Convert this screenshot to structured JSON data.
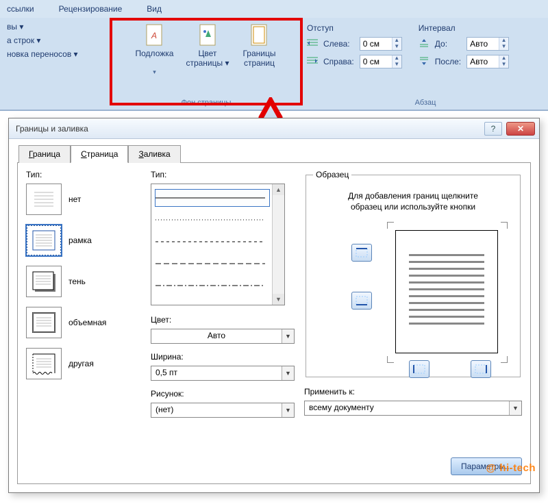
{
  "ribbon": {
    "tabs": [
      "ссылки",
      "Рецензирование",
      "Вид"
    ],
    "group_page_setup": {
      "items": [
        "вы ▾",
        "а строк ▾",
        "новка переносов ▾"
      ]
    },
    "group_page_bg": {
      "caption": "Фон страницы",
      "watermark": "Подложка",
      "page_color": "Цвет\nстраницы ▾",
      "page_borders": "Границы\nстраниц"
    },
    "group_indent": {
      "caption": "Отступ",
      "left_label": "Слева:",
      "right_label": "Справа:",
      "left_value": "0 см",
      "right_value": "0 см"
    },
    "group_spacing": {
      "caption": "Интервал",
      "before_label": "До:",
      "after_label": "После:",
      "before_value": "Авто",
      "after_value": "Авто"
    },
    "paragraph_caption": "Абзац"
  },
  "dialog": {
    "title": "Границы и заливка",
    "tabs": {
      "border": "Граница",
      "page": "Страница",
      "shading": "Заливка"
    },
    "type_label": "Тип:",
    "types": {
      "none": "нет",
      "box": "рамка",
      "shadow": "тень",
      "threeD": "объемная",
      "custom": "другая"
    },
    "style_label": "Тип:",
    "color_label": "Цвет:",
    "color_value": "Авто",
    "width_label": "Ширина:",
    "width_value": "0,5 пт",
    "art_label": "Рисунок:",
    "art_value": "(нет)",
    "preview_label": "Образец",
    "preview_hint": "Для добавления границ щелкните образец или используйте кнопки",
    "apply_label": "Применить к:",
    "apply_value": "всему документу",
    "params_btn": "Параметры..."
  },
  "watermark": "@ hi-tech"
}
